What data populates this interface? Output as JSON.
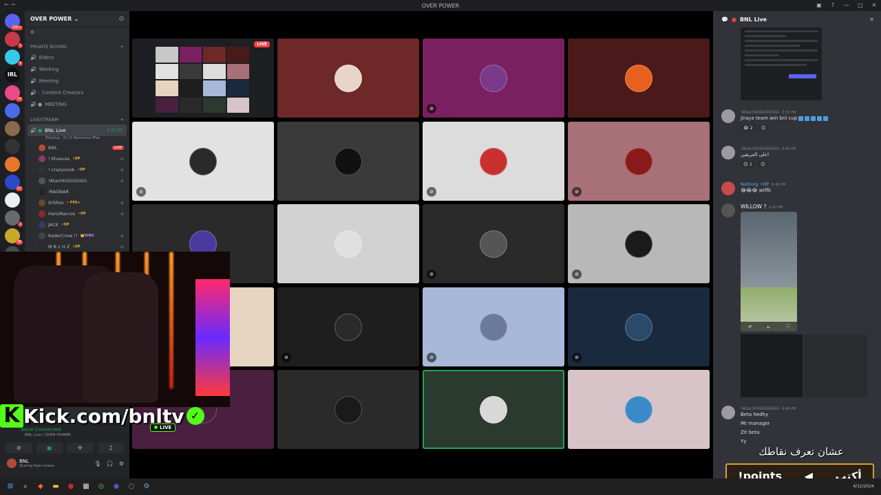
{
  "window": {
    "title": "OVER POWER"
  },
  "server": {
    "name": "OVER POWER"
  },
  "server_badges": [
    "16k+",
    "1",
    "4",
    "14",
    "12",
    "2",
    "38",
    "34"
  ],
  "channels": {
    "private_rooms_label": "PRIVATE ROOMS",
    "private_rooms": [
      "Elders",
      "Working",
      "Meeting",
      "Content Creators",
      "MEETING"
    ],
    "livestream_label": "LIVESTREAM",
    "live_channel": {
      "name": "BNL Live",
      "time": "1:22:23",
      "playing": "Playing: ·ℳ·ℳ Nemesse IIFar"
    },
    "users": [
      {
        "name": "BNL",
        "badge": "LIVE"
      },
      {
        "name": "! Khaoula",
        "tag": "⚡OP"
      },
      {
        "name": "! crazynoob",
        "tag": "⚡OP"
      },
      {
        "name": "!AtacHiiiiiiiiiiiiiiiiiii",
        "tag": ""
      },
      {
        "name": "!RAGNAR",
        "tag": ""
      },
      {
        "name": "9!SRzx",
        "tag": "⚡ FPS+"
      },
      {
        "name": "Hani/Narcos",
        "tag": "⚡OP"
      },
      {
        "name": "JACK",
        "tag": "⚡OP"
      },
      {
        "name": "KaderCrow !!",
        "tag": "👑KING"
      },
      {
        "name": "M B L H Z",
        "tag": "⚡OP"
      }
    ]
  },
  "voice": {
    "status": "Voice Connected",
    "sub": "BNL Live / OVER POWER",
    "user": {
      "name": "BNL",
      "status": "Sharing their screen"
    }
  },
  "stream_overlay": {
    "kick_k": "K",
    "kick_url": "Kick.com/bnltv",
    "check": "✓",
    "live_label": "LIVE"
  },
  "stage": {
    "live_badge": "LIVE"
  },
  "tiles": [
    {
      "bg": "#1e1f22",
      "avatar": "",
      "screen": true
    },
    {
      "bg": "#6e2828",
      "avatar": "#e8d4c8",
      "mute": false
    },
    {
      "bg": "#7a2060",
      "avatar": "#7a3a8c",
      "mute": true
    },
    {
      "bg": "#4a1a1a",
      "avatar": "#e86020",
      "mute": false
    },
    {
      "bg": "#e2e2e2",
      "avatar": "#2a2a2a",
      "mute": true
    },
    {
      "bg": "#3a3a3a",
      "avatar": "#111111",
      "mute": false
    },
    {
      "bg": "#dcdcdc",
      "avatar": "#c83030",
      "mute": true
    },
    {
      "bg": "#a87078",
      "avatar": "#8a1a1a",
      "mute": true
    },
    {
      "bg": "#2a2a2a",
      "avatar": "#4a3aa0",
      "mute": false
    },
    {
      "bg": "#d2d2d2",
      "avatar": "#e0e0e0",
      "mute": false
    },
    {
      "bg": "#2a2a2a",
      "avatar": "#555555",
      "mute": true
    },
    {
      "bg": "#b8b8b8",
      "avatar": "#1a1a1a",
      "mute": true
    },
    {
      "bg": "#e6d4c0",
      "avatar": "#e6d4c0",
      "mute": false
    },
    {
      "bg": "#1e1e1e",
      "avatar": "#2a2a2a",
      "mute": true
    },
    {
      "bg": "#a8b8d8",
      "avatar": "#6a7a9a",
      "mute": true
    },
    {
      "bg": "#1a2a3e",
      "avatar": "#2a4a6a",
      "mute": true
    },
    {
      "bg": "#4a2040",
      "avatar": "#4a2040",
      "mute": false
    },
    {
      "bg": "#2a2a2a",
      "avatar": "#1a1a1a",
      "mute": false
    },
    {
      "bg": "#2a3a2e",
      "avatar": "#d8d8d8",
      "mute": false,
      "speaking": true
    },
    {
      "bg": "#d8c4c8",
      "avatar": "#3a8ac8",
      "mute": false
    }
  ],
  "chat": {
    "title": "BNL Live",
    "messages": [
      {
        "name": "!AtacHiiiiiiiiiiiiiiiiiii",
        "time": "6:32 PM",
        "text": "Jiraya team win bnl cup",
        "reaction": "😂 2"
      },
      {
        "name": "!AtacHiiiiiiiiiiiiiiiiiii",
        "time": "6:40 PM",
        "text": "اعلى الفريقين",
        "reaction": "😊 1"
      },
      {
        "name": "Nothing ⚡OP",
        "time": "6:40 PM",
        "text": "😂😂😂 wtffk",
        "reaction": ""
      },
      {
        "name": "WILLOW ?",
        "time": "6:41 PM",
        "text": "",
        "reaction": ""
      },
      {
        "name": "!AtacHiiiiiiiiiiiiiiiiiii",
        "time": "6:46 PM",
        "text": "Beta hedhy",
        "reaction": ""
      }
    ],
    "extra_lines": [
      "Mt manager",
      "Zit beta",
      "Yy"
    ]
  },
  "promo": {
    "line1": "عشان تعرف نقاطك",
    "cmd": "!points",
    "arrow": "◀",
    "write": "أكتب"
  },
  "taskbar": {
    "date": "4/12/2024"
  }
}
